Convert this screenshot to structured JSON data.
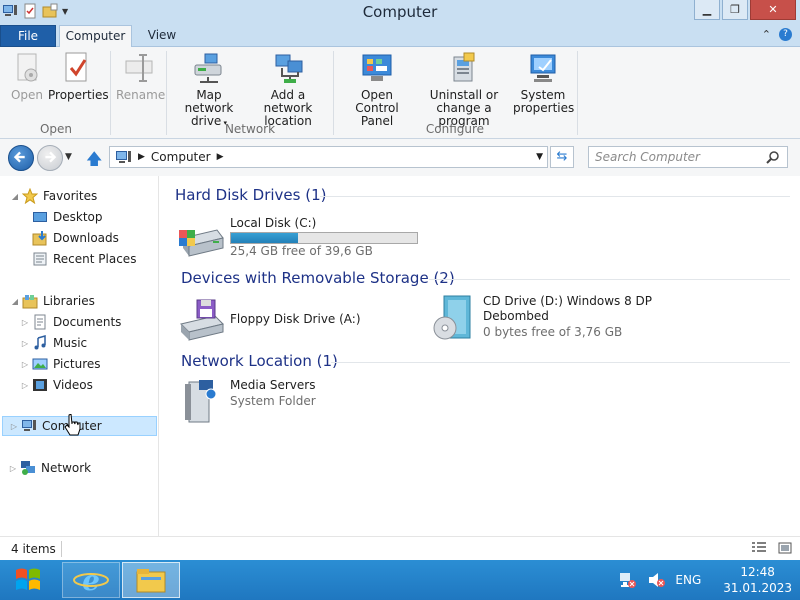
{
  "window": {
    "title": "Computer"
  },
  "ribbon": {
    "tabs": [
      {
        "label": "File"
      },
      {
        "label": "Computer"
      },
      {
        "label": "View"
      }
    ],
    "buttons": {
      "open": "Open",
      "properties": "Properties",
      "rename": "Rename",
      "map_network_drive_line1": "Map network",
      "map_network_drive_line2": "drive",
      "add_network_location_line1": "Add a network",
      "add_network_location_line2": "location",
      "open_control_panel_line1": "Open Control",
      "open_control_panel_line2": "Panel",
      "uninstall_line1": "Uninstall or",
      "uninstall_line2": "change a program",
      "system_properties_line1": "System",
      "system_properties_line2": "properties"
    },
    "groups": {
      "open": "Open",
      "network": "Network",
      "configure": "Configure"
    }
  },
  "address": {
    "crumb": "Computer",
    "search_placeholder": "Search Computer"
  },
  "nav": {
    "favorites": "Favorites",
    "desktop": "Desktop",
    "downloads": "Downloads",
    "recent_places": "Recent Places",
    "libraries": "Libraries",
    "documents": "Documents",
    "music": "Music",
    "pictures": "Pictures",
    "videos": "Videos",
    "computer": "Computer",
    "network": "Network"
  },
  "content": {
    "sections": {
      "hard_disk": "Hard Disk Drives (1)",
      "removable": "Devices with Removable Storage (2)",
      "network": "Network Location (1)"
    },
    "local_disk": {
      "name": "Local Disk (C:)",
      "free": "25,4 GB free of 39,6 GB",
      "used_fraction": 0.36
    },
    "floppy": {
      "name": "Floppy Disk Drive (A:)"
    },
    "cd": {
      "name_line1": "CD Drive (D:) Windows 8 DP",
      "name_line2": "Debombed",
      "free": "0 bytes free of 3,76 GB"
    },
    "media": {
      "name": "Media Servers",
      "type": "System Folder"
    }
  },
  "status": {
    "items": "4 items"
  },
  "taskbar": {
    "language": "ENG",
    "time": "12:48",
    "date": "31.01.2023"
  },
  "colors": {
    "title_bar": "#c9dff2",
    "file_tab": "#1f5fa8",
    "section_heading": "#1e3287",
    "taskbar": "#2283c9",
    "selection": "#cce8ff"
  }
}
